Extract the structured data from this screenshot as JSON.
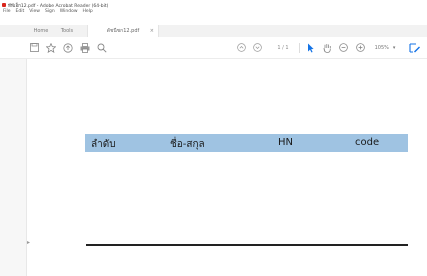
{
  "window": {
    "title": "ทีพีเอ็ก12.pdf - Adobe Acrobat Reader (64-bit)",
    "menu": [
      "File",
      "Edit",
      "View",
      "Sign",
      "Window",
      "Help"
    ]
  },
  "tabs": [
    {
      "label": "Home"
    },
    {
      "label": "Tools"
    },
    {
      "label": "ดัชนีชก12.pdf",
      "close": "×"
    }
  ],
  "toolbar": {
    "page_indicator": "1 / 1",
    "zoom_value": "105%",
    "zoom_dropdown": "▾",
    "icons": [
      "save-icon",
      "star-icon",
      "upload-icon",
      "print-icon",
      "search-icon",
      "prev-page-icon",
      "next-page-icon",
      "select-cursor-icon",
      "hand-icon",
      "zoom-out-icon",
      "zoom-in-icon",
      "fill-sign-icon"
    ],
    "accent_color": "#1473e6"
  },
  "document": {
    "table_headers": [
      "ลำดับ",
      "ชื่อ-สกุล",
      "HN",
      "code"
    ],
    "header_fill": "#9fc3e2"
  }
}
